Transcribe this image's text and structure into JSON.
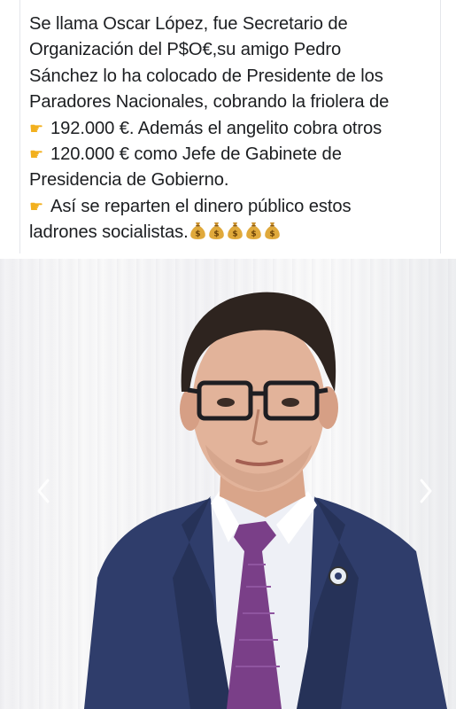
{
  "post": {
    "lines": [
      "Se llama Oscar López, fue Secretario de",
      "Organización del P$O€,su amigo Pedro",
      "Sánchez lo ha colocado de Presidente de los",
      "Paradores Nacionales, cobrando la friolera de",
      "192.000 €. Además el angelito cobra otros",
      "120.000 € como Jefe de Gabinete de",
      "Presidencia de Gobierno.",
      "Así se reparten el dinero público estos",
      "ladrones socialistas."
    ],
    "pointing_emoji": "👉",
    "money_bag_emoji": "💰"
  },
  "photo": {
    "prev_icon": "chevron-left-icon",
    "next_icon": "chevron-right-icon"
  },
  "colors": {
    "text": "#1c1e21",
    "suit": "#2f3d6b",
    "tie": "#7a3f88"
  }
}
